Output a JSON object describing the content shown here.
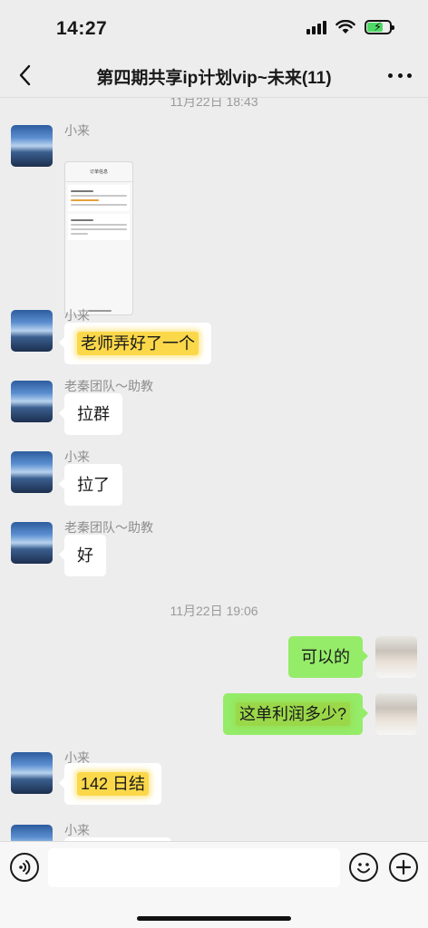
{
  "status_bar": {
    "time": "14:27",
    "icons": [
      "signal-icon",
      "wifi-icon",
      "battery-charging-icon"
    ],
    "battery_level": 0.7,
    "battery_color": "#4cd964"
  },
  "nav": {
    "back_icon": "chevron-left-icon",
    "title": "第四期共享ip计划vip~未来(11)",
    "more_icon": "more-dots-icon"
  },
  "chat": {
    "timestamp_top": "11月22日 18:43",
    "timestamp_mid": "11月22日 19:06",
    "messages": [
      {
        "sender": "小来",
        "type": "image"
      },
      {
        "sender": "小来",
        "text": "老师弄好了一个",
        "highlighted": true
      },
      {
        "sender": "老秦团队～助教",
        "text": "拉群"
      },
      {
        "sender": "小来",
        "text": "拉了"
      },
      {
        "sender": "老秦团队～助教",
        "text": "好"
      },
      {
        "sender": "me",
        "text": "可以的"
      },
      {
        "sender": "me",
        "text": "这单利润多少?",
        "highlighted": true
      },
      {
        "sender": "小来",
        "text": "142 日结",
        "highlighted": true
      },
      {
        "sender": "小来",
        "text": ""
      }
    ],
    "bubble_color_me": "#95ec69",
    "bubble_color_other": "#ffffff",
    "highlight_color": "#fbd84a",
    "image_thumb_title": "订单信息"
  },
  "input_bar": {
    "voice_icon": "voice-icon",
    "emoji_icon": "emoji-icon",
    "plus_icon": "plus-icon",
    "placeholder": ""
  }
}
